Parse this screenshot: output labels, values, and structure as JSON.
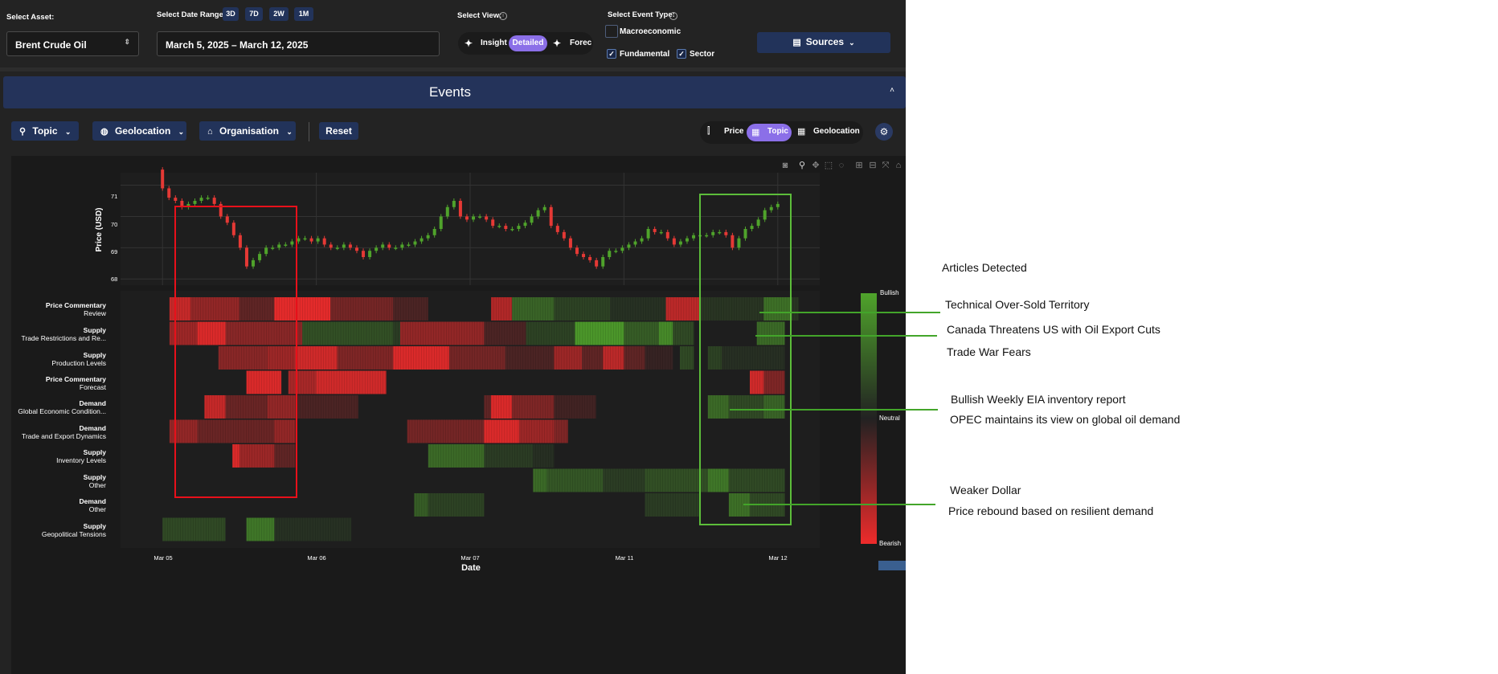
{
  "filters": {
    "asset_label": "Select Asset:",
    "asset_value": "Brent Crude Oil",
    "date_range_label": "Select Date Range:",
    "date_chips": [
      "3D",
      "7D",
      "2W",
      "1M"
    ],
    "date_value": "March 5, 2025 – March 12, 2025",
    "view_label": "Select View:",
    "view_options": [
      "Insight",
      "Detailed",
      "Forec"
    ],
    "view_selected": "Detailed",
    "event_type_label": "Select Event Type:",
    "event_types": [
      {
        "label": "Macroeconomic",
        "checked": false
      },
      {
        "label": "Fundamental",
        "checked": true
      },
      {
        "label": "Sector",
        "checked": true
      }
    ],
    "sources_label": "Sources"
  },
  "events": {
    "title": "Events",
    "group_buttons": [
      "Topic",
      "Geolocation",
      "Organisation"
    ],
    "reset_label": "Reset",
    "mode_options": [
      "Price",
      "Topic",
      "Geolocation"
    ],
    "mode_selected": "Topic"
  },
  "chart_data": {
    "type": "heatmap",
    "ylabel": "Price (USD)",
    "xlabel": "Date",
    "y_ticks": [
      68,
      69,
      70,
      71
    ],
    "x_ticks": [
      "Mar 05",
      "Mar 06",
      "Mar 07",
      "Mar 11",
      "Mar 12"
    ],
    "price_series": [
      70.9,
      70.6,
      70.5,
      70.3,
      70.4,
      70.5,
      70.6,
      70.6,
      70.4,
      70.0,
      69.8,
      69.4,
      69.0,
      68.4,
      68.6,
      68.8,
      69.0,
      69.0,
      69.1,
      69.1,
      69.2,
      69.3,
      69.3,
      69.2,
      69.3,
      69.1,
      69.0,
      69.0,
      69.1,
      69.0,
      68.9,
      68.7,
      68.9,
      69.0,
      69.1,
      69.0,
      69.0,
      69.1,
      69.1,
      69.2,
      69.3,
      69.4,
      69.6,
      70.0,
      70.3,
      70.5,
      70.0,
      69.9,
      70.0,
      70.0,
      69.9,
      69.7,
      69.7,
      69.6,
      69.6,
      69.7,
      69.8,
      70.0,
      70.2,
      70.3,
      69.7,
      69.5,
      69.3,
      69.0,
      68.8,
      68.7,
      68.6,
      68.4,
      68.7,
      68.9,
      68.9,
      69.0,
      69.1,
      69.2,
      69.3,
      69.6,
      69.5,
      69.5,
      69.3,
      69.1,
      69.2,
      69.3,
      69.4,
      69.4,
      69.4,
      69.5,
      69.5,
      69.4,
      69.0,
      69.3,
      69.6,
      69.7,
      69.9,
      70.2,
      70.3,
      70.4
    ],
    "rows": [
      {
        "category": "Price Commentary",
        "topic": "Review"
      },
      {
        "category": "Supply",
        "topic": "Trade Restrictions and Re..."
      },
      {
        "category": "Supply",
        "topic": "Production Levels"
      },
      {
        "category": "Price Commentary",
        "topic": "Forecast"
      },
      {
        "category": "Demand",
        "topic": "Global Economic Condition..."
      },
      {
        "category": "Demand",
        "topic": "Trade and Export Dynamics"
      },
      {
        "category": "Supply",
        "topic": "Inventory Levels"
      },
      {
        "category": "Supply",
        "topic": "Other"
      },
      {
        "category": "Demand",
        "topic": "Other"
      },
      {
        "category": "Supply",
        "topic": "Geopolitical Tensions"
      }
    ],
    "segments": [
      {
        "row": 0,
        "start": 0.07,
        "end": 0.1,
        "value": -0.8
      },
      {
        "row": 0,
        "start": 0.1,
        "end": 0.17,
        "value": -0.55
      },
      {
        "row": 0,
        "start": 0.17,
        "end": 0.22,
        "value": -0.3
      },
      {
        "row": 0,
        "start": 0.22,
        "end": 0.3,
        "value": -0.95
      },
      {
        "row": 0,
        "start": 0.3,
        "end": 0.39,
        "value": -0.4
      },
      {
        "row": 0,
        "start": 0.39,
        "end": 0.44,
        "value": -0.2
      },
      {
        "row": 0,
        "start": 0.53,
        "end": 0.56,
        "value": -0.7
      },
      {
        "row": 0,
        "start": 0.56,
        "end": 0.62,
        "value": 0.5
      },
      {
        "row": 0,
        "start": 0.62,
        "end": 0.7,
        "value": 0.25
      },
      {
        "row": 0,
        "start": 0.7,
        "end": 0.78,
        "value": 0.12
      },
      {
        "row": 0,
        "start": 0.78,
        "end": 0.83,
        "value": -0.75
      },
      {
        "row": 0,
        "start": 0.83,
        "end": 0.88,
        "value": -0.3
      },
      {
        "row": 0,
        "start": 0.83,
        "end": 0.97,
        "value": 0.15
      },
      {
        "row": 0,
        "start": 0.92,
        "end": 0.96,
        "value": 0.6
      },
      {
        "row": 1,
        "start": 0.07,
        "end": 0.11,
        "value": -0.6
      },
      {
        "row": 1,
        "start": 0.11,
        "end": 0.15,
        "value": -0.9
      },
      {
        "row": 1,
        "start": 0.15,
        "end": 0.26,
        "value": -0.5
      },
      {
        "row": 1,
        "start": 0.26,
        "end": 0.39,
        "value": 0.35
      },
      {
        "row": 1,
        "start": 0.39,
        "end": 0.4,
        "value": 0.2
      },
      {
        "row": 1,
        "start": 0.4,
        "end": 0.52,
        "value": -0.55
      },
      {
        "row": 1,
        "start": 0.52,
        "end": 0.58,
        "value": -0.2
      },
      {
        "row": 1,
        "start": 0.58,
        "end": 0.65,
        "value": 0.25
      },
      {
        "row": 1,
        "start": 0.65,
        "end": 0.72,
        "value": 0.9
      },
      {
        "row": 1,
        "start": 0.72,
        "end": 0.77,
        "value": 0.45
      },
      {
        "row": 1,
        "start": 0.77,
        "end": 0.79,
        "value": 0.8
      },
      {
        "row": 1,
        "start": 0.79,
        "end": 0.82,
        "value": 0.3
      },
      {
        "row": 1,
        "start": 0.91,
        "end": 0.95,
        "value": 0.55
      },
      {
        "row": 2,
        "start": 0.14,
        "end": 0.21,
        "value": -0.5
      },
      {
        "row": 2,
        "start": 0.21,
        "end": 0.25,
        "value": -0.6
      },
      {
        "row": 2,
        "start": 0.25,
        "end": 0.31,
        "value": -0.85
      },
      {
        "row": 2,
        "start": 0.31,
        "end": 0.39,
        "value": -0.45
      },
      {
        "row": 2,
        "start": 0.39,
        "end": 0.47,
        "value": -0.9
      },
      {
        "row": 2,
        "start": 0.47,
        "end": 0.55,
        "value": -0.4
      },
      {
        "row": 2,
        "start": 0.55,
        "end": 0.62,
        "value": -0.2
      },
      {
        "row": 2,
        "start": 0.62,
        "end": 0.66,
        "value": -0.6
      },
      {
        "row": 2,
        "start": 0.66,
        "end": 0.69,
        "value": -0.3
      },
      {
        "row": 2,
        "start": 0.69,
        "end": 0.72,
        "value": -0.75
      },
      {
        "row": 2,
        "start": 0.72,
        "end": 0.75,
        "value": -0.3
      },
      {
        "row": 2,
        "start": 0.75,
        "end": 0.79,
        "value": -0.1
      },
      {
        "row": 2,
        "start": 0.8,
        "end": 0.82,
        "value": 0.3
      },
      {
        "row": 2,
        "start": 0.84,
        "end": 0.86,
        "value": 0.25
      },
      {
        "row": 2,
        "start": 0.86,
        "end": 0.95,
        "value": 0.1
      },
      {
        "row": 3,
        "start": 0.18,
        "end": 0.23,
        "value": -0.9
      },
      {
        "row": 3,
        "start": 0.24,
        "end": 0.28,
        "value": -0.65
      },
      {
        "row": 3,
        "start": 0.28,
        "end": 0.38,
        "value": -0.85
      },
      {
        "row": 3,
        "start": 0.9,
        "end": 0.92,
        "value": -0.85
      },
      {
        "row": 3,
        "start": 0.92,
        "end": 0.95,
        "value": -0.45
      },
      {
        "row": 4,
        "start": 0.12,
        "end": 0.15,
        "value": -0.8
      },
      {
        "row": 4,
        "start": 0.15,
        "end": 0.21,
        "value": -0.35
      },
      {
        "row": 4,
        "start": 0.21,
        "end": 0.25,
        "value": -0.55
      },
      {
        "row": 4,
        "start": 0.25,
        "end": 0.34,
        "value": -0.2
      },
      {
        "row": 4,
        "start": 0.52,
        "end": 0.53,
        "value": -0.3
      },
      {
        "row": 4,
        "start": 0.53,
        "end": 0.56,
        "value": -0.9
      },
      {
        "row": 4,
        "start": 0.56,
        "end": 0.62,
        "value": -0.45
      },
      {
        "row": 4,
        "start": 0.62,
        "end": 0.68,
        "value": -0.15
      },
      {
        "row": 4,
        "start": 0.84,
        "end": 0.87,
        "value": 0.55
      },
      {
        "row": 4,
        "start": 0.87,
        "end": 0.92,
        "value": 0.3
      },
      {
        "row": 4,
        "start": 0.92,
        "end": 0.95,
        "value": 0.5
      },
      {
        "row": 5,
        "start": 0.07,
        "end": 0.11,
        "value": -0.55
      },
      {
        "row": 5,
        "start": 0.11,
        "end": 0.22,
        "value": -0.35
      },
      {
        "row": 5,
        "start": 0.22,
        "end": 0.25,
        "value": -0.55
      },
      {
        "row": 5,
        "start": 0.41,
        "end": 0.52,
        "value": -0.4
      },
      {
        "row": 5,
        "start": 0.52,
        "end": 0.57,
        "value": -0.9
      },
      {
        "row": 5,
        "start": 0.57,
        "end": 0.62,
        "value": -0.6
      },
      {
        "row": 5,
        "start": 0.62,
        "end": 0.64,
        "value": -0.45
      },
      {
        "row": 6,
        "start": 0.16,
        "end": 0.17,
        "value": -0.9
      },
      {
        "row": 6,
        "start": 0.17,
        "end": 0.22,
        "value": -0.6
      },
      {
        "row": 6,
        "start": 0.22,
        "end": 0.25,
        "value": -0.3
      },
      {
        "row": 6,
        "start": 0.44,
        "end": 0.52,
        "value": 0.55
      },
      {
        "row": 6,
        "start": 0.52,
        "end": 0.59,
        "value": 0.2
      },
      {
        "row": 6,
        "start": 0.59,
        "end": 0.62,
        "value": 0.1
      },
      {
        "row": 7,
        "start": 0.59,
        "end": 0.61,
        "value": 0.55
      },
      {
        "row": 7,
        "start": 0.61,
        "end": 0.69,
        "value": 0.4
      },
      {
        "row": 7,
        "start": 0.69,
        "end": 0.75,
        "value": 0.2
      },
      {
        "row": 7,
        "start": 0.75,
        "end": 0.84,
        "value": 0.35
      },
      {
        "row": 7,
        "start": 0.84,
        "end": 0.87,
        "value": 0.65
      },
      {
        "row": 7,
        "start": 0.87,
        "end": 0.95,
        "value": 0.3
      },
      {
        "row": 8,
        "start": 0.42,
        "end": 0.44,
        "value": 0.45
      },
      {
        "row": 8,
        "start": 0.44,
        "end": 0.52,
        "value": 0.25
      },
      {
        "row": 8,
        "start": 0.75,
        "end": 0.83,
        "value": 0.2
      },
      {
        "row": 8,
        "start": 0.87,
        "end": 0.9,
        "value": 0.6
      },
      {
        "row": 8,
        "start": 0.9,
        "end": 0.95,
        "value": 0.3
      },
      {
        "row": 9,
        "start": 0.06,
        "end": 0.15,
        "value": 0.3
      },
      {
        "row": 9,
        "start": 0.18,
        "end": 0.22,
        "value": 0.65
      },
      {
        "row": 9,
        "start": 0.22,
        "end": 0.33,
        "value": 0.12
      }
    ],
    "colorbar": {
      "top": "Bullish",
      "mid": "Neutral",
      "bottom": "Bearish"
    }
  },
  "annotations": {
    "header": "Articles Detected",
    "items": [
      "Technical Over-Sold Territory",
      "Canada Threatens US with Oil Export Cuts",
      "Trade War Fears",
      "Bullish Weekly EIA inventory report",
      "OPEC maintains its view on global oil demand",
      "Weaker Dollar",
      "Price rebound based on resilient demand"
    ]
  },
  "colors": {
    "bullish": "#4fa32b",
    "bearish": "#ee2b2b",
    "highlight_red": "#e8101a",
    "highlight_green": "#5cbd3a",
    "accent": "#8b6fe8"
  }
}
